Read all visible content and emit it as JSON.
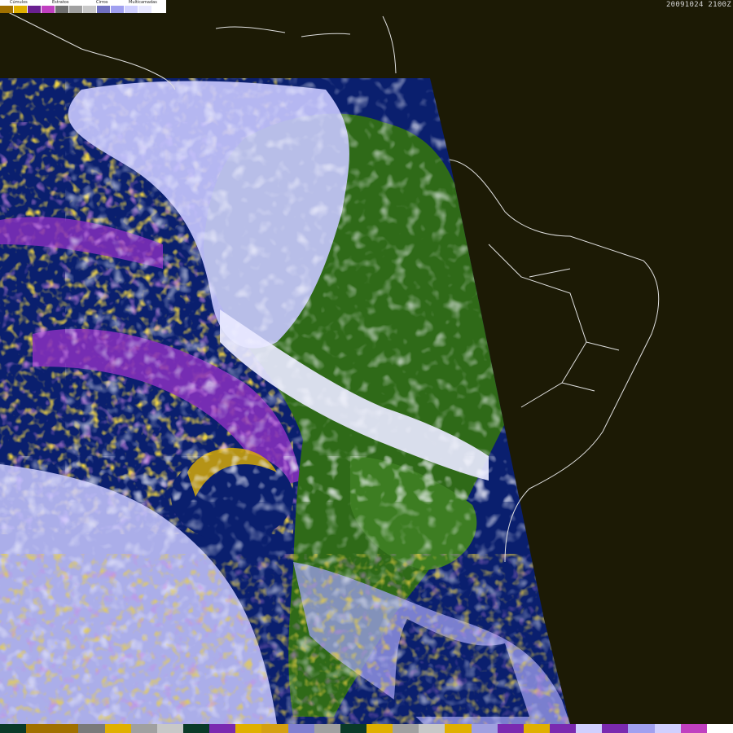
{
  "legend": {
    "cumulus_label": "Cúmulos",
    "stratus_label": "Estratos",
    "cirrus_label": "Cirros",
    "multilayer_label": "Multicamadas",
    "swatches": [
      "#a07000",
      "#e0b000",
      "#6a2090",
      "#c040c0",
      "#707070",
      "#a0a0a0",
      "#c8c8c8",
      "#7070c0",
      "#a0a0f0",
      "#d0d0ff",
      "#e8e8ff",
      "#ffffff"
    ]
  },
  "timestamp": "20091024 2100Z",
  "colors": {
    "background": "#1c1a05",
    "ocean": "#0a1f6e",
    "land_green": "#2f6a18",
    "cloud_light": "#c8c8ff",
    "cloud_white": "#f0f0ff",
    "cumulus": "#d4a010",
    "stratus": "#9a3cc8",
    "coastline": "#e0e0e0"
  },
  "bottom_bar": [
    "#0a3a28",
    "#a07000",
    "#a07000",
    "#7a7a7a",
    "#e0b000",
    "#a0a0a0",
    "#c8c8c8",
    "#0a3a28",
    "#7a2ab0",
    "#e0b000",
    "#d4a010",
    "#8080d0",
    "#a0a0a0",
    "#0a3a28",
    "#e0b000",
    "#a0a0a0",
    "#c8c8c8",
    "#e0b000",
    "#a0a0e0",
    "#7a2ab0",
    "#e0b000",
    "#7a2ab0",
    "#d0d0ff",
    "#7a2ab0",
    "#a0a0f0",
    "#d0d0ff",
    "#c040c0",
    "#ffffff"
  ]
}
